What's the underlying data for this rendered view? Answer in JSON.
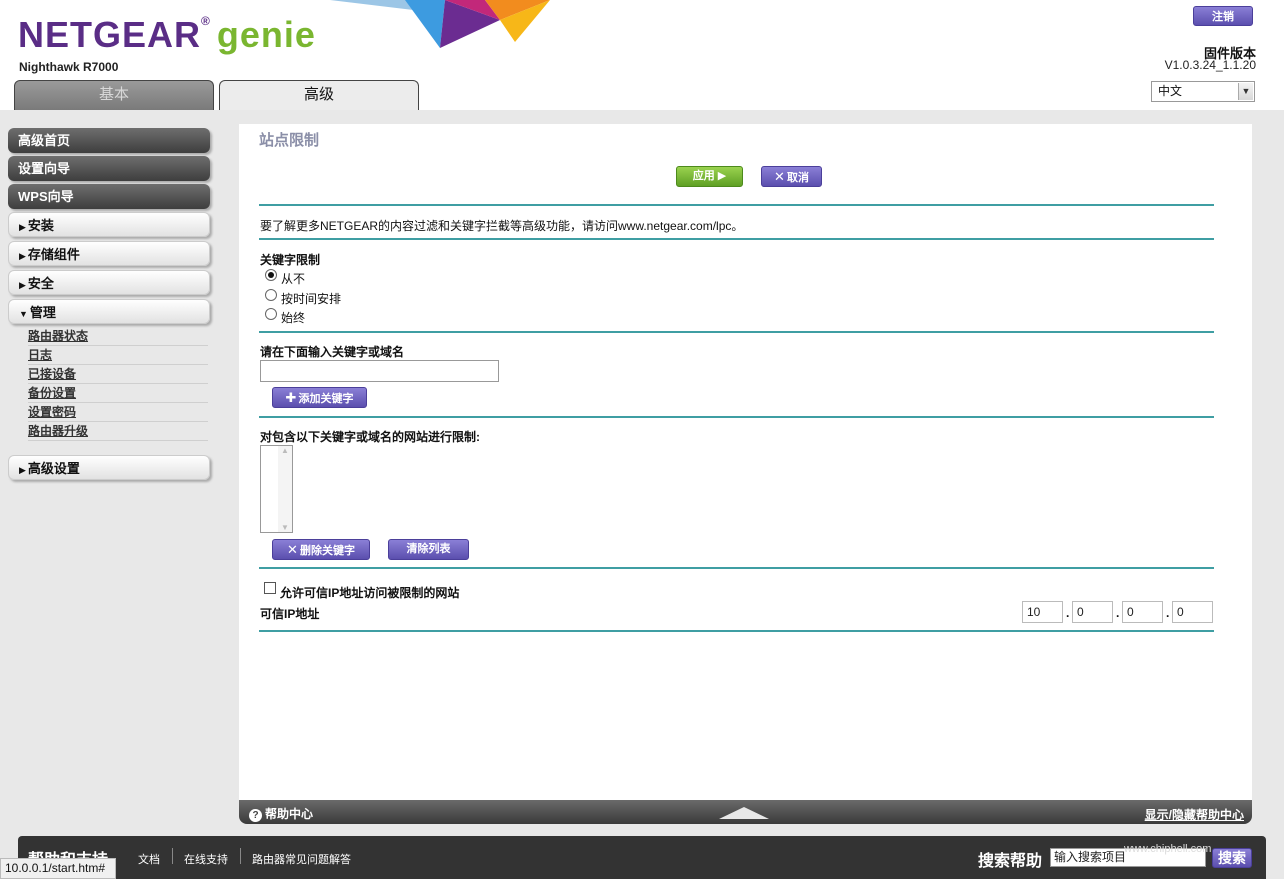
{
  "header": {
    "logo_brand": "NETGEAR",
    "logo_reg": "®",
    "logo_genie": "genie",
    "model": "Nighthawk R7000",
    "logout_label": "注销",
    "firmware_label": "固件版本",
    "firmware_version": "V1.0.3.24_1.1.20",
    "language": "中文",
    "tabs": [
      {
        "label": "基本",
        "active": false
      },
      {
        "label": "高级",
        "active": true
      }
    ]
  },
  "sidebar": {
    "dark_items": [
      "高级首页",
      "设置向导",
      "WPS向导"
    ],
    "items": [
      {
        "label": "安装",
        "expanded": false
      },
      {
        "label": "存储组件",
        "expanded": false
      },
      {
        "label": "安全",
        "expanded": false
      },
      {
        "label": "管理",
        "expanded": true
      },
      {
        "label": "高级设置",
        "expanded": false
      }
    ],
    "management_subitems": [
      "路由器状态",
      "日志",
      "已接设备",
      "备份设置",
      "设置密码",
      "路由器升级"
    ]
  },
  "content": {
    "title": "站点限制",
    "apply_label": "应用 ▶",
    "cancel_label": "取消",
    "info_text": "要了解更多NETGEAR的内容过滤和关键字拦截等高级功能，请访问www.netgear.com/lpc。",
    "keyword_section_title": "关键字限制",
    "radio_options": [
      {
        "label": "从不",
        "selected": true
      },
      {
        "label": "按时间安排",
        "selected": false
      },
      {
        "label": "始终",
        "selected": false
      }
    ],
    "input_prompt": "请在下面输入关键字或域名",
    "keyword_input_value": "",
    "add_keyword_label": "添加关键字",
    "blocked_list_title": "对包含以下关键字或域名的网站进行限制:",
    "blocked_list": [],
    "delete_keyword_label": "删除关键字",
    "clear_list_label": "清除列表",
    "trusted_ip_checkbox_label": "允许可信IP地址访问被限制的网站",
    "trusted_ip_checked": false,
    "trusted_ip_label": "可信IP地址",
    "trusted_ip": [
      "10",
      "0",
      "0",
      "0"
    ]
  },
  "help_bar": {
    "title": "帮助中心",
    "toggle_label": "显示/隐藏帮助中心"
  },
  "footer": {
    "title": "帮助和支持",
    "links": [
      "文档",
      "在线支持",
      "路由器常见问题解答"
    ],
    "search_label": "搜索帮助",
    "search_placeholder": "输入搜索项目",
    "search_button": "搜索"
  },
  "status_url": "10.0.0.1/start.htm#",
  "watermark": "www.chiphell.com",
  "colors": {
    "brand_purple": "#5a2d86",
    "genie_green": "#7ab630",
    "section_rule": "#3f9ea3",
    "button_purple": "#5b4fae",
    "button_green": "#5fa024"
  },
  "icons": {
    "apply": "play-arrow-icon",
    "cancel": "close-icon",
    "add": "plus-icon",
    "delete": "close-icon",
    "help": "question-circle-icon",
    "select": "chevron-down-icon"
  }
}
